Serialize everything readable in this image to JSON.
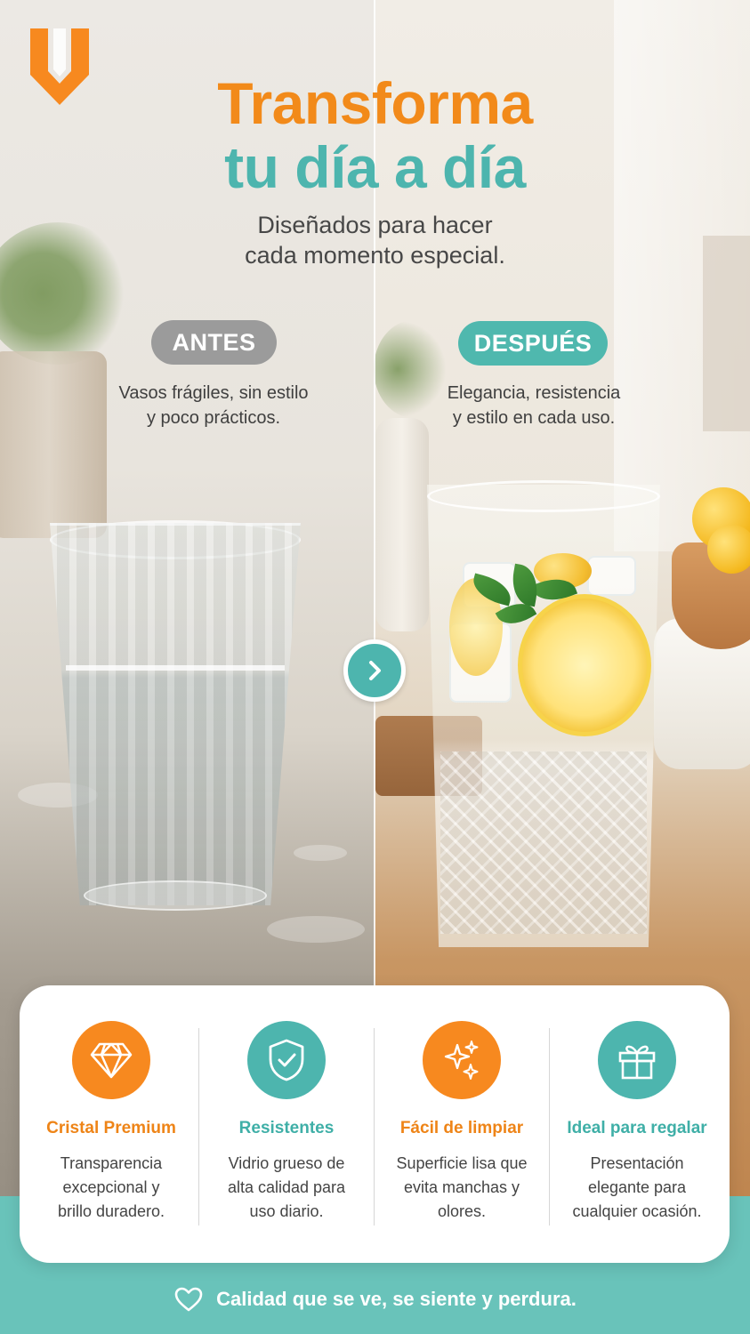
{
  "brand": {
    "logo_icon": "brand-logo-u-icon",
    "accent_orange": "#f7891f",
    "accent_teal": "#4db5ae"
  },
  "header": {
    "title_line1": "Transforma",
    "title_line2": "tu día a día",
    "subtitle_line1": "Diseñados para hacer",
    "subtitle_line2": "cada momento especial."
  },
  "comparison": {
    "before": {
      "label": "ANTES",
      "caption_line1": "Vasos frágiles, sin estilo",
      "caption_line2": "y poco prácticos."
    },
    "after": {
      "label": "DESPUÉS",
      "caption_line1": "Elegancia, resistencia",
      "caption_line2": "y estilo en cada uso."
    },
    "arrow_icon": "chevron-right-icon"
  },
  "features": [
    {
      "icon": "diamond-icon",
      "title": "Cristal Premium",
      "desc": [
        "Transparencia",
        "excepcional y",
        "brillo duradero."
      ]
    },
    {
      "icon": "shield-check-icon",
      "title": "Resistentes",
      "desc": [
        "Vidrio grueso de",
        "alta calidad para",
        "uso diario."
      ]
    },
    {
      "icon": "sparkles-icon",
      "title": "Fácil de limpiar",
      "desc": [
        "Superficie lisa que",
        "evita manchas y",
        "olores."
      ]
    },
    {
      "icon": "gift-icon",
      "title": "Ideal para regalar",
      "desc": [
        "Presentación",
        "elegante para",
        "cualquier ocasión."
      ]
    }
  ],
  "footer": {
    "icon": "heart-icon",
    "text": "Calidad que se ve, se siente y perdura."
  }
}
